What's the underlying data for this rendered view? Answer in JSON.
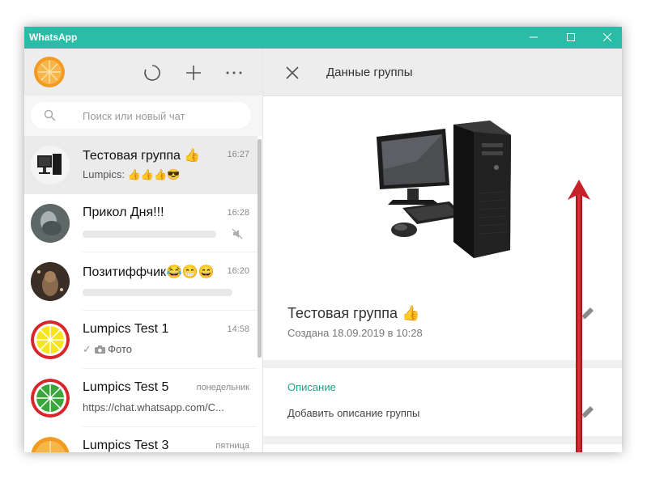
{
  "window": {
    "title": "WhatsApp"
  },
  "sidebar": {
    "search": {
      "placeholder": "Поиск или новый чат"
    },
    "chats": [
      {
        "name": "Тестовая группа 👍",
        "time": "16:27",
        "preview": "Lumpics: 👍👍👍😎",
        "active": true
      },
      {
        "name": "Прикол Дня!!!",
        "time": "16:28",
        "preview": "",
        "muted": true
      },
      {
        "name": "Позитиффчик😂😁😄",
        "time": "16:20",
        "preview": ""
      },
      {
        "name": "Lumpics Test 1",
        "time": "14:58",
        "preview": "Фото"
      },
      {
        "name": "Lumpics Test 5",
        "time": "понедельник",
        "preview": "https://chat.whatsapp.com/C..."
      },
      {
        "name": "Lumpics Test 3",
        "time": "пятница",
        "preview": ""
      }
    ]
  },
  "details": {
    "title": "Данные группы",
    "group_name": "Тестовая группа 👍",
    "created": "Создана 18.09.2019 в 10:28",
    "description_label": "Описание",
    "description_placeholder": "Добавить описание группы"
  },
  "colors": {
    "titlebar": "#2abca6",
    "accent": "#1fa38d",
    "arrow": "#d41f2a"
  }
}
